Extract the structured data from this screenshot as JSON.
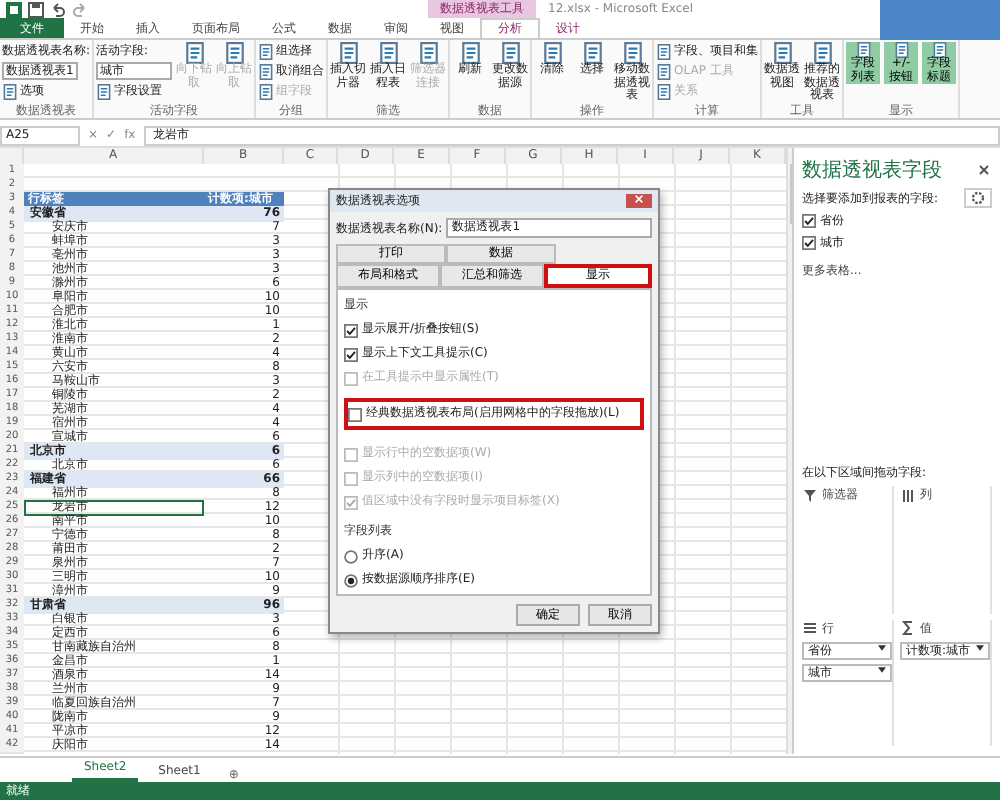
{
  "window": {
    "title": "12.xlsx - Microsoft Excel",
    "context_tab_group": "数据透视表工具"
  },
  "ribbon_tabs": [
    {
      "label": "文件",
      "selected": false,
      "kind": "file"
    },
    {
      "label": "开始",
      "selected": false,
      "kind": "normal"
    },
    {
      "label": "插入",
      "selected": false,
      "kind": "normal"
    },
    {
      "label": "页面布局",
      "selected": false,
      "kind": "normal"
    },
    {
      "label": "公式",
      "selected": false,
      "kind": "normal"
    },
    {
      "label": "数据",
      "selected": false,
      "kind": "normal"
    },
    {
      "label": "审阅",
      "selected": false,
      "kind": "normal"
    },
    {
      "label": "视图",
      "selected": false,
      "kind": "normal"
    },
    {
      "label": "分析",
      "selected": true,
      "kind": "context"
    },
    {
      "label": "设计",
      "selected": false,
      "kind": "context"
    }
  ],
  "ribbon_groups": [
    {
      "label": "数据透视表",
      "items": [
        {
          "kind": "label",
          "text": "数据透视表名称:",
          "disabled": false
        },
        {
          "kind": "field",
          "text": "数据透视表1",
          "disabled": false
        },
        {
          "kind": "small",
          "text": "选项",
          "disabled": false
        }
      ]
    },
    {
      "label": "活动字段",
      "items": [
        {
          "kind": "label",
          "text": "活动字段:",
          "disabled": false
        },
        {
          "kind": "field",
          "text": "城市",
          "disabled": false
        },
        {
          "kind": "small",
          "text": "字段设置",
          "disabled": false
        },
        {
          "kind": "large",
          "text": "向下钻取",
          "disabled": true
        },
        {
          "kind": "large",
          "text": "向上钻取",
          "disabled": true
        }
      ]
    },
    {
      "label": "分组",
      "items": [
        {
          "kind": "small",
          "text": "组选择",
          "disabled": false
        },
        {
          "kind": "small",
          "text": "取消组合",
          "disabled": false
        },
        {
          "kind": "small",
          "text": "组字段",
          "disabled": true
        }
      ]
    },
    {
      "label": "筛选",
      "items": [
        {
          "kind": "large",
          "text": "插入切片器",
          "disabled": false
        },
        {
          "kind": "large",
          "text": "插入日程表",
          "disabled": false
        },
        {
          "kind": "large",
          "text": "筛选器连接",
          "disabled": true
        }
      ]
    },
    {
      "label": "数据",
      "items": [
        {
          "kind": "large",
          "text": "刷新",
          "disabled": false
        },
        {
          "kind": "large",
          "text": "更改数据源",
          "disabled": false
        }
      ]
    },
    {
      "label": "操作",
      "items": [
        {
          "kind": "large",
          "text": "清除",
          "disabled": false
        },
        {
          "kind": "large",
          "text": "选择",
          "disabled": false
        },
        {
          "kind": "large",
          "text": "移动数据透视表",
          "disabled": false
        }
      ]
    },
    {
      "label": "计算",
      "items": [
        {
          "kind": "small",
          "text": "字段、项目和集",
          "disabled": false
        },
        {
          "kind": "small",
          "text": "OLAP 工具",
          "disabled": true
        },
        {
          "kind": "small",
          "text": "关系",
          "disabled": true
        }
      ]
    },
    {
      "label": "工具",
      "items": [
        {
          "kind": "large",
          "text": "数据透视图",
          "disabled": false
        },
        {
          "kind": "large",
          "text": "推荐的数据透视表",
          "disabled": false
        }
      ]
    },
    {
      "label": "显示",
      "items": [
        {
          "kind": "toggle",
          "text": "字段列表",
          "on": true
        },
        {
          "kind": "toggle",
          "text": "+/- 按钮",
          "on": true
        },
        {
          "kind": "toggle",
          "text": "字段标题",
          "on": true
        }
      ]
    }
  ],
  "formula_bar": {
    "name_box": "A25",
    "cancel": "×",
    "enter": "✓",
    "fx": "fx",
    "value": "龙岩市"
  },
  "columns": [
    "A",
    "B",
    "C",
    "D",
    "E",
    "F",
    "G",
    "H",
    "I",
    "J",
    "K"
  ],
  "pivot_rows": [
    {
      "num": "1",
      "kind": "blank"
    },
    {
      "num": "2",
      "kind": "blank"
    },
    {
      "num": "3",
      "kind": "header",
      "label": "行标签",
      "count": "计数项:城市"
    },
    {
      "num": "4",
      "kind": "group",
      "label": "安徽省",
      "count": "76"
    },
    {
      "num": "5",
      "kind": "item",
      "label": "安庆市",
      "count": "7",
      "selected": false
    },
    {
      "num": "6",
      "kind": "item",
      "label": "蚌埠市",
      "count": "3",
      "selected": false
    },
    {
      "num": "7",
      "kind": "item",
      "label": "亳州市",
      "count": "3",
      "selected": false
    },
    {
      "num": "8",
      "kind": "item",
      "label": "池州市",
      "count": "3",
      "selected": false
    },
    {
      "num": "9",
      "kind": "item",
      "label": "滁州市",
      "count": "6",
      "selected": false
    },
    {
      "num": "10",
      "kind": "item",
      "label": "阜阳市",
      "count": "10",
      "selected": false
    },
    {
      "num": "11",
      "kind": "item",
      "label": "合肥市",
      "count": "10",
      "selected": false
    },
    {
      "num": "12",
      "kind": "item",
      "label": "淮北市",
      "count": "1",
      "selected": false
    },
    {
      "num": "13",
      "kind": "item",
      "label": "淮南市",
      "count": "2",
      "selected": false
    },
    {
      "num": "14",
      "kind": "item",
      "label": "黄山市",
      "count": "4",
      "selected": false
    },
    {
      "num": "15",
      "kind": "item",
      "label": "六安市",
      "count": "8",
      "selected": false
    },
    {
      "num": "16",
      "kind": "item",
      "label": "马鞍山市",
      "count": "3",
      "selected": false
    },
    {
      "num": "17",
      "kind": "item",
      "label": "铜陵市",
      "count": "2",
      "selected": false
    },
    {
      "num": "18",
      "kind": "item",
      "label": "芜湖市",
      "count": "4",
      "selected": false
    },
    {
      "num": "19",
      "kind": "item",
      "label": "宿州市",
      "count": "4",
      "selected": false
    },
    {
      "num": "20",
      "kind": "item",
      "label": "宣城市",
      "count": "6",
      "selected": false
    },
    {
      "num": "21",
      "kind": "group",
      "label": "北京市",
      "count": "6"
    },
    {
      "num": "22",
      "kind": "item",
      "label": "北京市",
      "count": "6",
      "selected": false
    },
    {
      "num": "23",
      "kind": "group",
      "label": "福建省",
      "count": "66"
    },
    {
      "num": "24",
      "kind": "item",
      "label": "福州市",
      "count": "8",
      "selected": false
    },
    {
      "num": "25",
      "kind": "item",
      "label": "龙岩市",
      "count": "12",
      "selected": true
    },
    {
      "num": "26",
      "kind": "item",
      "label": "南平市",
      "count": "10",
      "selected": false
    },
    {
      "num": "27",
      "kind": "item",
      "label": "宁德市",
      "count": "8",
      "selected": false
    },
    {
      "num": "28",
      "kind": "item",
      "label": "莆田市",
      "count": "2",
      "selected": false
    },
    {
      "num": "29",
      "kind": "item",
      "label": "泉州市",
      "count": "7",
      "selected": false
    },
    {
      "num": "30",
      "kind": "item",
      "label": "三明市",
      "count": "10",
      "selected": false
    },
    {
      "num": "31",
      "kind": "item",
      "label": "漳州市",
      "count": "9",
      "selected": false
    },
    {
      "num": "32",
      "kind": "group",
      "label": "甘肃省",
      "count": "96"
    },
    {
      "num": "33",
      "kind": "item",
      "label": "白银市",
      "count": "3",
      "selected": false
    },
    {
      "num": "34",
      "kind": "item",
      "label": "定西市",
      "count": "6",
      "selected": false
    },
    {
      "num": "35",
      "kind": "item",
      "label": "甘南藏族自治州",
      "count": "8",
      "selected": false
    },
    {
      "num": "36",
      "kind": "item",
      "label": "金昌市",
      "count": "1",
      "selected": false
    },
    {
      "num": "37",
      "kind": "item",
      "label": "酒泉市",
      "count": "14",
      "selected": false
    },
    {
      "num": "38",
      "kind": "item",
      "label": "兰州市",
      "count": "9",
      "selected": false
    },
    {
      "num": "39",
      "kind": "item",
      "label": "临夏回族自治州",
      "count": "7",
      "selected": false
    },
    {
      "num": "40",
      "kind": "item",
      "label": "陇南市",
      "count": "9",
      "selected": false
    },
    {
      "num": "41",
      "kind": "item",
      "label": "平凉市",
      "count": "12",
      "selected": false
    },
    {
      "num": "42",
      "kind": "item",
      "label": "庆阳市",
      "count": "14",
      "selected": false
    }
  ],
  "dialog": {
    "title": "数据透视表选项",
    "name_label": "数据透视表名称(N):",
    "name_value": "数据透视表1",
    "tab_rows": [
      [
        {
          "label": "打印",
          "selected": false,
          "highlighted": false
        },
        {
          "label": "数据",
          "selected": false,
          "highlighted": false
        }
      ],
      [
        {
          "label": "布局和格式",
          "selected": false,
          "highlighted": false
        },
        {
          "label": "汇总和筛选",
          "selected": false,
          "highlighted": false
        },
        {
          "label": "显示",
          "selected": true,
          "highlighted": true
        }
      ]
    ],
    "section": "显示",
    "options": [
      {
        "label": "显示展开/折叠按钮(S)",
        "checked": true,
        "disabled": false,
        "highlighted": false
      },
      {
        "label": "显示上下文工具提示(C)",
        "checked": true,
        "disabled": false,
        "highlighted": false
      },
      {
        "label": "在工具提示中显示属性(T)",
        "checked": false,
        "disabled": true,
        "highlighted": false
      },
      {
        "label": "经典数据透视表布局(启用网格中的字段拖放)(L)",
        "checked": false,
        "disabled": false,
        "highlighted": true
      },
      {
        "label": "显示行中的空数据项(W)",
        "checked": false,
        "disabled": true,
        "highlighted": false
      },
      {
        "label": "显示列中的空数据项(I)",
        "checked": false,
        "disabled": true,
        "highlighted": false
      },
      {
        "label": "值区域中没有字段时显示项目标签(X)",
        "checked": true,
        "disabled": true,
        "highlighted": false
      }
    ],
    "sort_label": "字段列表",
    "sort_options": [
      {
        "label": "升序(A)",
        "selected": false
      },
      {
        "label": "按数据源顺序排序(E)",
        "selected": true
      }
    ],
    "buttons": [
      "确定",
      "取消"
    ]
  },
  "field_pane": {
    "title": "数据透视表字段",
    "subtitle": "选择要添加到报表的字段:",
    "fields": [
      {
        "label": "省份",
        "checked": true
      },
      {
        "label": "城市",
        "checked": true
      }
    ],
    "more_tables": "更多表格...",
    "drag_hint": "在以下区域间拖动字段:",
    "areas": [
      {
        "kind": "filter",
        "label": "筛选器"
      },
      {
        "kind": "columns",
        "label": "列"
      },
      {
        "kind": "rows",
        "label": "行",
        "items": [
          "省份",
          "城市"
        ]
      },
      {
        "kind": "values",
        "label": "值",
        "items": [
          "计数项:城市"
        ]
      }
    ]
  },
  "sheet_tabs": [
    {
      "label": "Sheet2",
      "selected": true
    },
    {
      "label": "Sheet1",
      "selected": false
    }
  ],
  "add_sheet": "⊕",
  "status_bar": {
    "text": "就绪"
  }
}
